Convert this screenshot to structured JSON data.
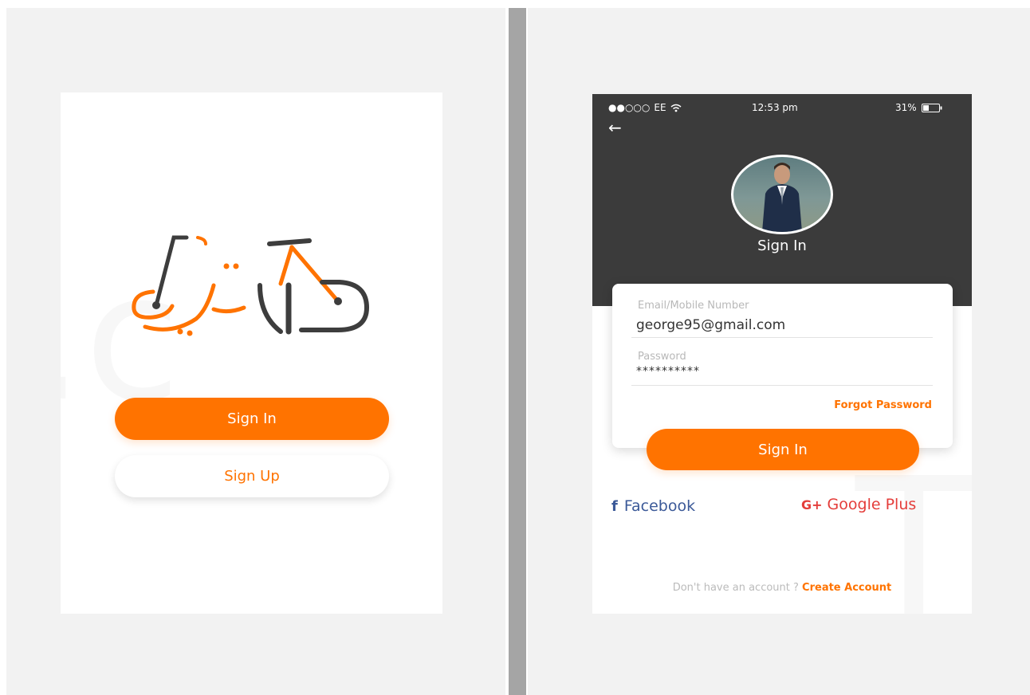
{
  "colors": {
    "accent": "#ff7300",
    "dark": "#3b3b3b",
    "facebook": "#3b5998",
    "google": "#e43d3a"
  },
  "left_screen": {
    "logo_icon": "bike-logo-icon",
    "sign_in_label": "Sign In",
    "sign_up_label": "Sign Up"
  },
  "right_screen": {
    "status_bar": {
      "signal": "●●○○○",
      "carrier": "EE",
      "wifi_icon": "wifi-icon",
      "time": "12:53 pm",
      "battery": "31%",
      "battery_icon": "battery-icon"
    },
    "back_icon": "back-arrow-icon",
    "title": "Sign In",
    "form": {
      "email_label": "Email/Mobile Number",
      "email_value": "george95@gmail.com",
      "password_label": "Password",
      "password_value": "**********",
      "forgot_link": "Forgot Password"
    },
    "sign_in_label": "Sign In",
    "social": {
      "facebook_glyph": "f",
      "facebook_label": "Facebook",
      "google_glyph": "G+",
      "google_label": "Google Plus"
    },
    "footer": {
      "text": "Don't have an account ? ",
      "link": "Create Account"
    }
  }
}
